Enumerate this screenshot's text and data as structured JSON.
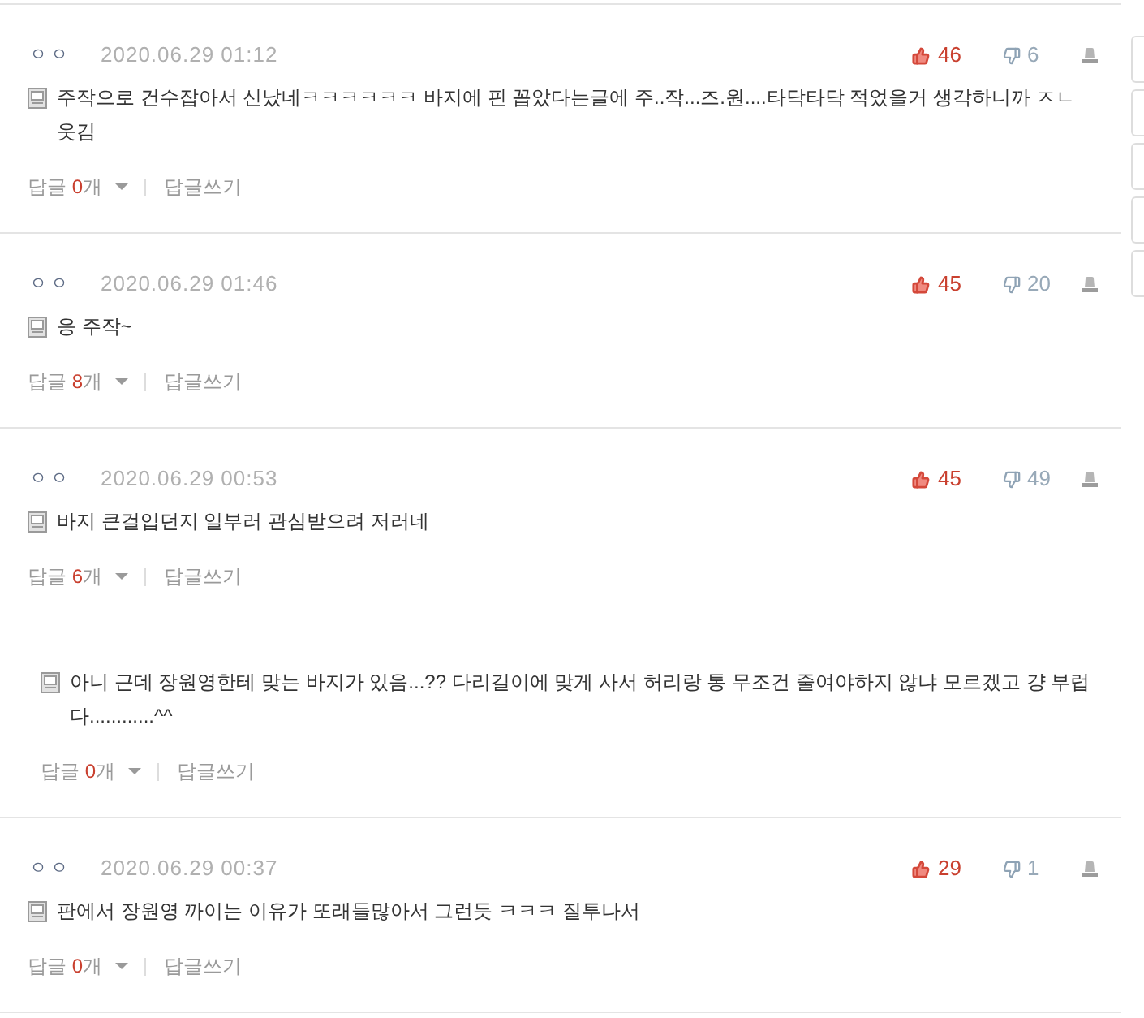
{
  "comments": [
    {
      "author": "ㅇㅇ",
      "date": "2020.06.29 01:12",
      "likes": "46",
      "dislikes": "6",
      "text": "주작으로 건수잡아서 신났네ㅋㅋㅋㅋㅋㅋ 바지에 핀 꼽았다는글에 주..작...즈.원....타닥타닥 적었을거 생각하니까 ㅈㄴ웃김",
      "replies_toggle": {
        "label": "답글",
        "count": "0",
        "unit": "개"
      },
      "write_reply": "답글쓰기"
    },
    {
      "author": "ㅇㅇ",
      "date": "2020.06.29 01:46",
      "likes": "45",
      "dislikes": "20",
      "text": "응 주작~",
      "replies_toggle": {
        "label": "답글",
        "count": "8",
        "unit": "개"
      },
      "write_reply": "답글쓰기"
    },
    {
      "author": "ㅇㅇ",
      "date": "2020.06.29 00:53",
      "likes": "45",
      "dislikes": "49",
      "text": "바지 큰걸입던지 일부러 관심받으려 저러네",
      "replies_toggle": {
        "label": "답글",
        "count": "6",
        "unit": "개"
      },
      "write_reply": "답글쓰기",
      "replies": [
        {
          "text": "아니 근데 장원영한테 맞는 바지가 있음...?? 다리길이에 맞게 사서 허리랑 통 무조건 줄여야하지 않냐 모르겠고 걍 부럽다............^^",
          "replies_toggle": {
            "label": "답글",
            "count": "0",
            "unit": "개"
          },
          "write_reply": "답글쓰기"
        }
      ]
    },
    {
      "author": "ㅇㅇ",
      "date": "2020.06.29 00:37",
      "likes": "29",
      "dislikes": "1",
      "text": "판에서 장원영 까이는 이유가 또래들많아서 그런듯 ㅋㅋㅋ 질투나서",
      "replies_toggle": {
        "label": "답글",
        "count": "0",
        "unit": "개"
      },
      "write_reply": "답글쓰기"
    }
  ]
}
